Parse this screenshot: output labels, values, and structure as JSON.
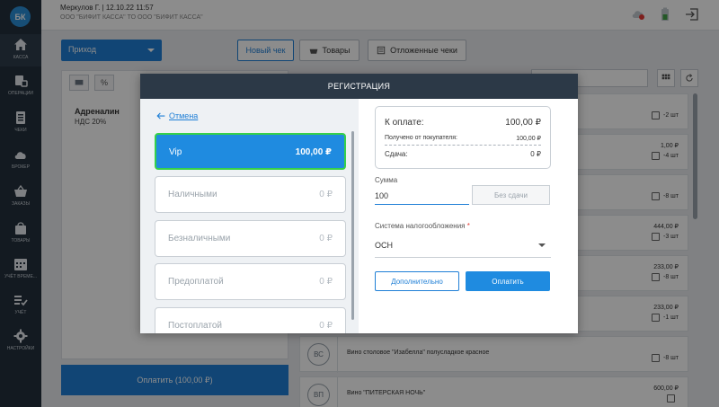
{
  "app": {
    "logo": "БК"
  },
  "sidebar": {
    "items": [
      {
        "label": "КАССА",
        "icon": "home-icon",
        "active": true
      },
      {
        "label": "ОПЕРАЦИИ",
        "icon": "operations-icon"
      },
      {
        "label": "ЧЕКИ",
        "icon": "receipts-icon"
      },
      {
        "label": "БРОКЕР",
        "icon": "cloud-icon"
      },
      {
        "label": "ЗАКАЗЫ",
        "icon": "basket-icon"
      },
      {
        "label": "ТОВАРЫ",
        "icon": "bag-icon"
      },
      {
        "label": "УЧЁТ ВРЕМЕ...",
        "icon": "calendar-icon"
      },
      {
        "label": "УЧЁТ",
        "icon": "checklist-icon"
      },
      {
        "label": "НАСТРОЙКИ",
        "icon": "gear-icon"
      }
    ]
  },
  "header": {
    "user": "Меркулов Г.  |  12.10.22 11:57",
    "org": "ООО \"БИФИТ КАССА\" ТО ООО \"БИФИТ КАССА\""
  },
  "toolbar": {
    "operation_select": "Приход",
    "new_receipt": "Новый чек",
    "goods": "Товары",
    "deferred": "Отложенные чеки"
  },
  "cart": {
    "item_name": "Адреналин",
    "item_vat": "НДС 20%",
    "pay_button": "Оплатить (100,00 ₽)"
  },
  "goods_list": [
    {
      "avatar": "",
      "name": "",
      "price": "",
      "qty": "-2 шт"
    },
    {
      "avatar": "",
      "name": "",
      "price": "1,00 ₽",
      "qty": "-4 шт"
    },
    {
      "avatar": "",
      "name": "",
      "price": "",
      "qty": "-8 шт"
    },
    {
      "avatar": "",
      "name": "",
      "price": "444,00 ₽",
      "qty": "-3 шт"
    },
    {
      "avatar": "",
      "name": "",
      "price": "233,00 ₽",
      "qty": "-8 шт"
    },
    {
      "avatar": "",
      "name": "",
      "price": "233,00 ₽",
      "qty": "-1 шт"
    },
    {
      "avatar": "ВС",
      "name": "Вино столовое \"Изабелла\" полусладкое красное",
      "price": "",
      "qty": "-8 шт"
    },
    {
      "avatar": "ВП",
      "name": "Вино \"ПИТЕРСКАЯ НОЧЬ\"",
      "price": "600,00 ₽",
      "qty": ""
    }
  ],
  "modal": {
    "title": "РЕГИСТРАЦИЯ",
    "back": "Отмена",
    "payment_methods": [
      {
        "name": "Vip",
        "amount": "100,00 ₽",
        "selected": true
      },
      {
        "name": "Наличными",
        "amount": "0 ₽"
      },
      {
        "name": "Безналичными",
        "amount": "0 ₽"
      },
      {
        "name": "Предоплатой",
        "amount": "0 ₽"
      },
      {
        "name": "Постоплатой",
        "amount": "0 ₽"
      }
    ],
    "summary": {
      "to_pay_label": "К оплате:",
      "to_pay_value": "100,00 ₽",
      "received_label": "Получено от покупателя:",
      "received_value": "100,00 ₽",
      "change_label": "Сдача:",
      "change_value": "0 ₽"
    },
    "sum_label": "Сумма",
    "sum_value": "100",
    "no_change": "Без сдачи",
    "tax_label": "Система налогообложения",
    "tax_required": "*",
    "tax_value": "ОСН",
    "extra_button": "Дополнительно",
    "pay_button": "Оплатить"
  },
  "colors": {
    "accent": "#1f8be0",
    "sidebar": "#23303d",
    "selected_border": "#36d04a",
    "modal_header": "#2c3947"
  }
}
